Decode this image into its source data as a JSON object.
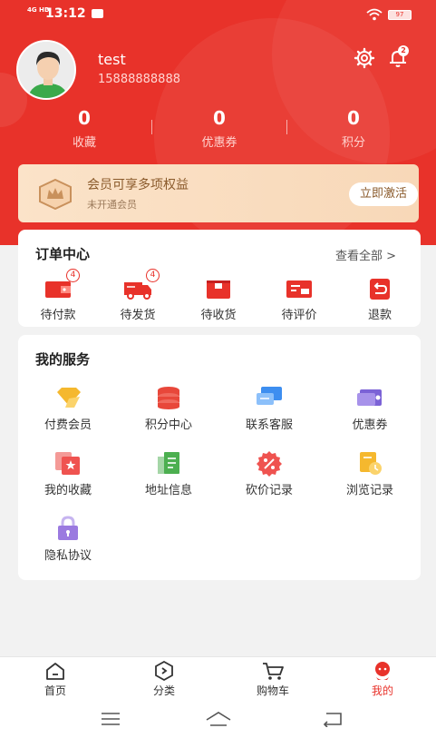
{
  "status_bar": {
    "network": "4G HD",
    "time": "13:12",
    "battery": "97"
  },
  "profile": {
    "username": "test",
    "phone": "15888888888",
    "notification_count": "2"
  },
  "stats": [
    {
      "value": "0",
      "label": "收藏"
    },
    {
      "value": "0",
      "label": "优惠券"
    },
    {
      "value": "0",
      "label": "积分"
    }
  ],
  "membership": {
    "title": "会员可享多项权益",
    "subtitle": "未开通会员",
    "button": "立即激活"
  },
  "orders": {
    "title": "订单中心",
    "view_all": "查看全部 >",
    "items": [
      {
        "label": "待付款",
        "badge": "4",
        "icon": "wallet-icon"
      },
      {
        "label": "待发货",
        "badge": "4",
        "icon": "truck-icon"
      },
      {
        "label": "待收货",
        "badge": "",
        "icon": "box-icon"
      },
      {
        "label": "待评价",
        "badge": "",
        "icon": "review-icon"
      },
      {
        "label": "退款",
        "badge": "",
        "icon": "refund-icon"
      }
    ]
  },
  "services": {
    "title": "我的服务",
    "items": [
      {
        "label": "付费会员",
        "icon": "diamond-icon",
        "color": "#f5b82e"
      },
      {
        "label": "积分中心",
        "icon": "coins-icon",
        "color": "#e8473a"
      },
      {
        "label": "联系客服",
        "icon": "chat-icon",
        "color": "#3d8ef0"
      },
      {
        "label": "优惠券",
        "icon": "coupon-icon",
        "color": "#7b62d6"
      },
      {
        "label": "我的收藏",
        "icon": "favorite-icon",
        "color": "#ef5350"
      },
      {
        "label": "地址信息",
        "icon": "address-icon",
        "color": "#4caf50"
      },
      {
        "label": "砍价记录",
        "icon": "bargain-icon",
        "color": "#ef5350"
      },
      {
        "label": "浏览记录",
        "icon": "history-icon",
        "color": "#f5b82e"
      },
      {
        "label": "隐私协议",
        "icon": "lock-icon",
        "color": "#9b7ae0"
      }
    ]
  },
  "tabbar": [
    {
      "label": "首页",
      "icon": "home-icon"
    },
    {
      "label": "分类",
      "icon": "category-icon"
    },
    {
      "label": "购物车",
      "icon": "cart-icon"
    },
    {
      "label": "我的",
      "icon": "profile-icon",
      "active": true
    }
  ],
  "colors": {
    "primary": "#e8322a",
    "member_text": "#8a5a2b"
  }
}
